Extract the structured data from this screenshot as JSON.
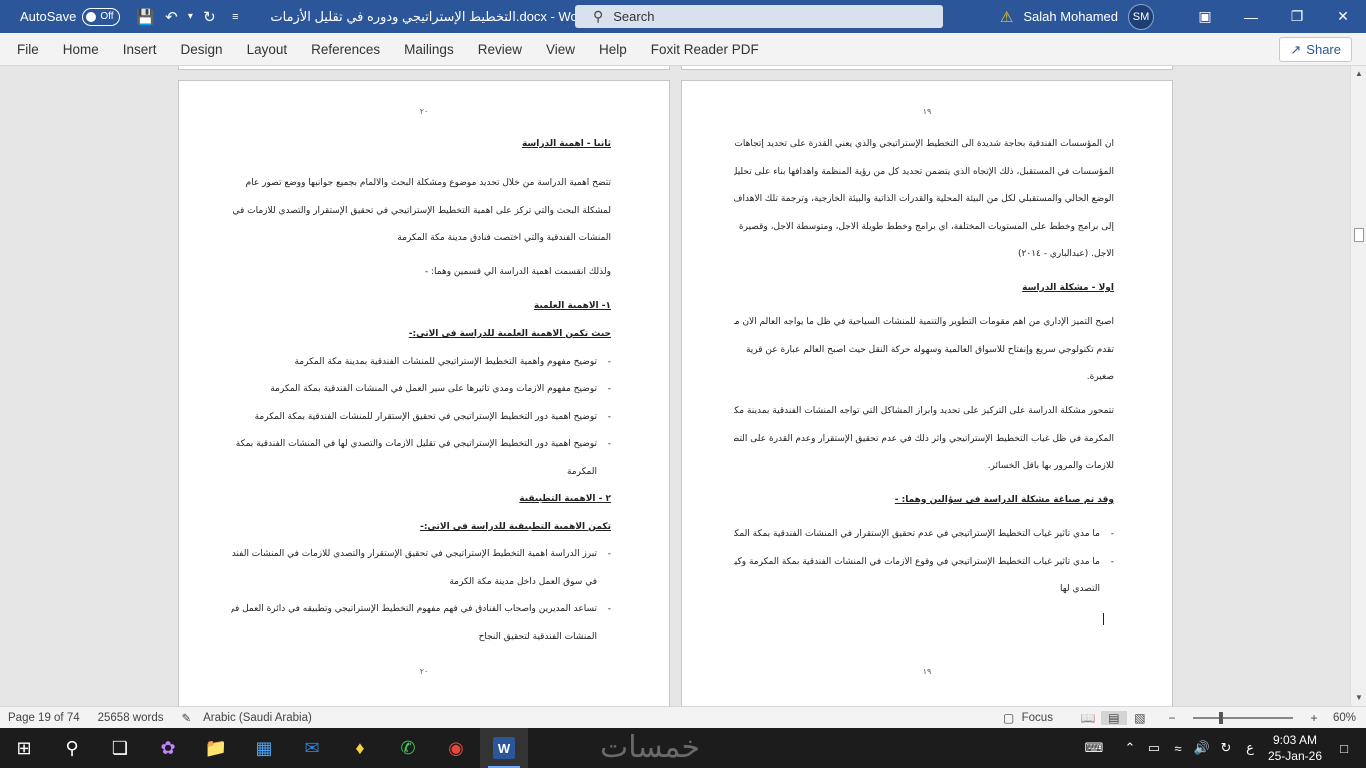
{
  "titlebar": {
    "autosave_label": "AutoSave",
    "autosave_state": "Off",
    "doc_title": "التخطيط الإستراتيجي ودوره في تقليل الأزمات.docx - Word",
    "search_placeholder": "Search",
    "user_name": "Salah Mohamed",
    "user_initials": "SM"
  },
  "ribbon": {
    "tabs": [
      "File",
      "Home",
      "Insert",
      "Design",
      "Layout",
      "References",
      "Mailings",
      "Review",
      "View",
      "Help",
      "Foxit Reader PDF"
    ],
    "share_label": "Share"
  },
  "pages": {
    "left": {
      "page_number": "٢٠",
      "footer_number": "٢٠",
      "lines": [
        "ثانيا - أهمية الدراسة",
        "تتضح أهمية الدراسة من خلال تحديد موضوع ومشكلة البحث والالمام بجميع جوانبها ووضع تصور عام",
        "لمشكلة البحث والتي تركز على أهمية التخطيط الإستراتيجي في تحقيق الإستقرار والتصدي للازمات في",
        "المنشآت الفندقية والتي اختصت فنادق مدينة مكة المكرمة",
        "ولذلك انقسمت أهمية الدراسة الي قسمين وهما: -",
        "١-   الاهمية العلمية",
        "حيث تكمن الاهمية العلمية للدراسة في الاتي:-",
        "توضيح مفهوم وأهمية التخطيط الإستراتيجي للمنشآت الفندقية بمدينة مكة المكرمة",
        "توضيح مفهوم الأزمات ومدي تأثيرها على سير العمل في المنشآت الفندقية بمكة المكرمة",
        "توضيح أهمية دور التخطيط الإستراتيجي في تحقيق الإستقرار للمنشآت الفندقية بمكة المكرمة",
        "توضيح أهمية دور التخطيط الإستراتيجي في تقليل الأزمات والتصدي لها في المنشآت الفندقية بمكة",
        "المكرمة",
        "٢   - الاهمية التطبيقية",
        "تكمن الاهمية التطبيقية للدراسة في الاتي:-",
        "تبرز الدراسة أهمية التخطيط الإستراتيجي في تحقيق الإستقرار والتصدي للازمات في المنشآت الفندقية",
        "في سوق العمل داخل مدينة مكة الكرمة",
        "تساعد المديرين واصحاب الفنادق في فهم مفهوم التخطيط الإستراتيجي وتطبيقه في دائرة العمل في",
        "المنشآت الفندقية لتحقيق النجاح"
      ]
    },
    "right": {
      "page_number": "١٩",
      "footer_number": "١٩",
      "lines": [
        "ان المؤسسات الفندقية بحاجة شديدة الى التخطيط الإستراتيجي والذي يعني القدرة على تحديد إتجاهات",
        "المؤسسات في المستقبل، ذلك الإتجاه الذي يتضمن تحديد كل من رؤية المنظمة وأهدافها بناء على تحليل",
        "الوضع الحالي والمستقبلي لكل من البيئة المحلية والقدرات الذاتية والبيئة الخارجية، وترجمة تلك الأهداف",
        "إلى برامج وخطط على المستويات المختلفة، أي برامج وخطط طويلة الأجل، ومتوسطة الأجل، وقصيرة",
        "الأجل.  (عبدالباري - ٢٠١٤)",
        "اولا - مشكلة الدراسة",
        "أصبح التميز الإداري من أهم مقومات التطوير والتنمية للمنشآت السياحية في ظل ما يواجه العالم الأن من",
        "تقدم تكنولوجي سريع وإنفتاح للأسواق العالمية وسهوله حركة النقل حيث أصبح العالم عبارة عن قرية",
        "صغيرة.",
        "تتمحور مشكلة الدراسة على التركيز على تحديد وابراز المشاكل التي تواجه المنشآت الفندقية بمدينة مكة",
        "المكرمة في ظل غياب التخطيط الإستراتيجي وأثر ذلك في عدم تحقيق الإستقرار وعدم القدرة على التصدي",
        "للازمات والمرور بها بأقل الخسائر.",
        "وقد تم صياغة مشكلة الدراسة في سؤالين وهما: -",
        "ما مدي تأثير غياب التخطيط الإستراتيجي في عدم تحقيق الإستقرار في المنشآت الفندقية بمكة المكرمة",
        "ما مدي تأثير غياب التخطيط الإستراتيجي في وقوع الأزمات في المنشآت الفندقية بمكة المكرمة وكيفية",
        "التصدي لها"
      ]
    }
  },
  "statusbar": {
    "page_info": "Page 19 of 74",
    "word_count": "25658 words",
    "language": "Arabic (Saudi Arabia)",
    "focus_label": "Focus",
    "zoom": "60%"
  },
  "taskbar": {
    "watermark": "خمسات",
    "time": "9:03 AM",
    "date": "25-Jan-26",
    "input_lang": "ع"
  }
}
